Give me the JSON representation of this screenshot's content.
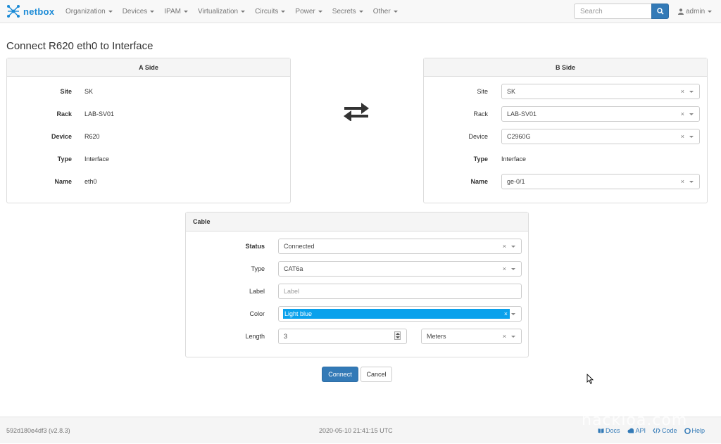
{
  "brand": {
    "name": "netbox"
  },
  "nav": {
    "items": [
      {
        "label": "Organization"
      },
      {
        "label": "Devices"
      },
      {
        "label": "IPAM"
      },
      {
        "label": "Virtualization"
      },
      {
        "label": "Circuits"
      },
      {
        "label": "Power"
      },
      {
        "label": "Secrets"
      },
      {
        "label": "Other"
      }
    ],
    "search_placeholder": "Search",
    "user": "admin"
  },
  "page": {
    "title": "Connect R620 eth0 to Interface"
  },
  "a_side": {
    "heading": "A Side",
    "fields": [
      {
        "label": "Site",
        "value": "SK"
      },
      {
        "label": "Rack",
        "value": "LAB-SV01"
      },
      {
        "label": "Device",
        "value": "R620"
      },
      {
        "label": "Type",
        "value": "Interface"
      },
      {
        "label": "Name",
        "value": "eth0"
      }
    ]
  },
  "b_side": {
    "heading": "B Side",
    "site_label": "Site",
    "site_value": "SK",
    "rack_label": "Rack",
    "rack_value": "LAB-SV01",
    "device_label": "Device",
    "device_value": "C2960G",
    "type_label": "Type",
    "type_value": "Interface",
    "name_label": "Name",
    "name_value": "ge-0/1",
    "clear_glyph": "×"
  },
  "cable": {
    "heading": "Cable",
    "status_label": "Status",
    "status_value": "Connected",
    "type_label": "Type",
    "type_value": "CAT6a",
    "label_label": "Label",
    "label_placeholder": "Label",
    "color_label": "Color",
    "color_value": "Light blue",
    "length_label": "Length",
    "length_value": "3",
    "length_unit": "Meters",
    "clear_glyph": "×"
  },
  "buttons": {
    "connect": "Connect",
    "cancel": "Cancel"
  },
  "footer": {
    "version": "592d180e4df3 (v2.8.3)",
    "timestamp": "2020-05-10 21:41:15 UTC",
    "links": [
      {
        "label": "Docs"
      },
      {
        "label": "API"
      },
      {
        "label": "Code"
      },
      {
        "label": "Help"
      }
    ]
  },
  "watermark": "nackloa.com",
  "colors": {
    "brand": "#1a8ad6",
    "primary": "#337ab7",
    "highlight": "#0aa1ec"
  }
}
